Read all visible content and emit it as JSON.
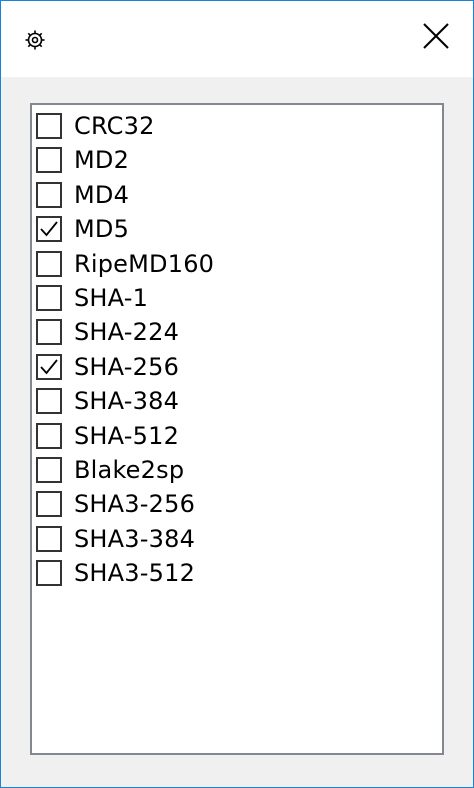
{
  "window": {
    "title_icon": "gear-icon",
    "close_icon": "close-icon",
    "border_color": "#1883d7"
  },
  "hash_list": {
    "items": [
      {
        "label": "CRC32",
        "checked": false
      },
      {
        "label": "MD2",
        "checked": false
      },
      {
        "label": "MD4",
        "checked": false
      },
      {
        "label": "MD5",
        "checked": true
      },
      {
        "label": "RipeMD160",
        "checked": false
      },
      {
        "label": "SHA-1",
        "checked": false
      },
      {
        "label": "SHA-224",
        "checked": false
      },
      {
        "label": "SHA-256",
        "checked": true
      },
      {
        "label": "SHA-384",
        "checked": false
      },
      {
        "label": "SHA-512",
        "checked": false
      },
      {
        "label": "Blake2sp",
        "checked": false
      },
      {
        "label": "SHA3-256",
        "checked": false
      },
      {
        "label": "SHA3-384",
        "checked": false
      },
      {
        "label": "SHA3-512",
        "checked": false
      }
    ]
  }
}
